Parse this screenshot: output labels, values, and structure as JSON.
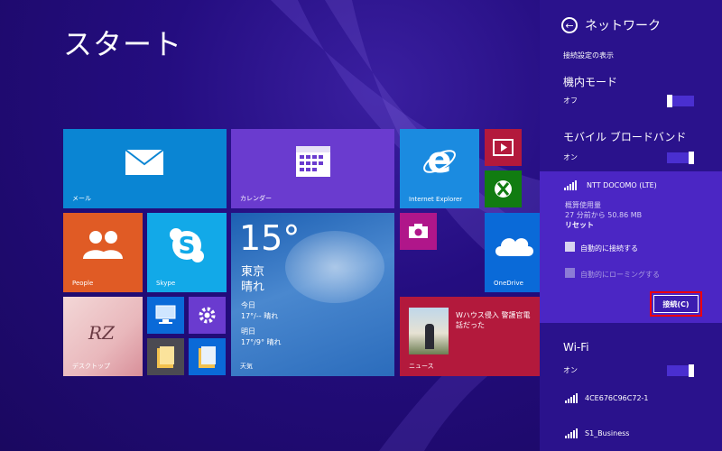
{
  "start": {
    "title": "スタート",
    "tiles": {
      "mail": "メール",
      "calendar": "カレンダー",
      "ie": "Internet Explorer",
      "people": "People",
      "skype": "Skype",
      "onedrive": "OneDrive",
      "desktop": "デスクトップ",
      "news": "ニュース",
      "weather_label": "天気"
    },
    "weather": {
      "temp": "15°",
      "city": "東京",
      "condition": "晴れ",
      "today_label": "今日",
      "today_forecast": "17°/-- 晴れ",
      "tomorrow_label": "明日",
      "tomorrow_forecast": "17°/9° 晴れ"
    },
    "news_headline": "Wハウス侵入 警護官電話だった",
    "desktop_thumb_text": "RZ"
  },
  "network": {
    "title": "ネットワーク",
    "show_settings": "接続設定の表示",
    "airplane": {
      "label": "機内モード",
      "state": "オフ"
    },
    "mobile": {
      "label": "モバイル ブロードバンド",
      "state": "オン"
    },
    "carrier": "NTT DOCOMO (LTE)",
    "usage_label": "概算使用量",
    "usage_value": "27 分前から 50.86 MB",
    "reset": "リセット",
    "auto_connect": "自動的に接続する",
    "auto_roaming": "自動的にローミングする",
    "connect_button": "接続(C)",
    "wifi": {
      "label": "Wi-Fi",
      "state": "オン"
    },
    "networks": [
      "4CE676C96C72-1",
      "S1_Business"
    ]
  },
  "colors": {
    "start_bg": "#240d80",
    "panel_bg": "#2a128c",
    "card_bg": "#4b26c4",
    "mail": "#0a85d3",
    "calendar": "#6a3bcf",
    "ie": "#1b8be0",
    "people": "#e05b25",
    "skype": "#12a9e8",
    "onedrive": "#0a6ad8",
    "news": "#b3193c",
    "video": "#b3193c",
    "xbox": "#117c11",
    "camera": "#b0168a",
    "settings": "#6a3bcf",
    "highlight": "#ee0000"
  }
}
